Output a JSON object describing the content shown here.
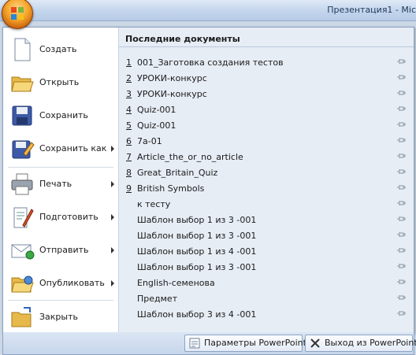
{
  "window": {
    "title": "Презентация1 - Mic"
  },
  "menu_commands": [
    {
      "label": "Создать",
      "has_submenu": false,
      "icon": "new-document-icon"
    },
    {
      "label": "Открыть",
      "has_submenu": false,
      "icon": "open-folder-icon"
    },
    {
      "label": "Сохранить",
      "has_submenu": false,
      "icon": "save-disk-icon"
    },
    {
      "label": "Сохранить как",
      "has_submenu": true,
      "icon": "save-as-icon"
    },
    {
      "label": "Печать",
      "has_submenu": true,
      "icon": "printer-icon"
    },
    {
      "label": "Подготовить",
      "has_submenu": true,
      "icon": "prepare-document-icon"
    },
    {
      "label": "Отправить",
      "has_submenu": true,
      "icon": "send-mail-icon"
    },
    {
      "label": "Опубликовать",
      "has_submenu": true,
      "icon": "publish-folder-icon"
    },
    {
      "label": "Закрыть",
      "has_submenu": false,
      "icon": "close-folder-icon"
    }
  ],
  "recent": {
    "header": "Последние документы",
    "items": [
      {
        "num": "1",
        "name": "001_Заготовка создания тестов"
      },
      {
        "num": "2",
        "name": "УРОКИ-конкурс"
      },
      {
        "num": "3",
        "name": "УРОКИ-конкурс"
      },
      {
        "num": "4",
        "name": "Quiz-001"
      },
      {
        "num": "5",
        "name": "Quiz-001"
      },
      {
        "num": "6",
        "name": "7а-01"
      },
      {
        "num": "7",
        "name": "Article_the_or_no_article"
      },
      {
        "num": "8",
        "name": "Great_Britain_Quiz"
      },
      {
        "num": "9",
        "name": "British Symbols"
      },
      {
        "num": "",
        "name": "к тесту"
      },
      {
        "num": "",
        "name": "Шаблон выбор 1 из 3 -001"
      },
      {
        "num": "",
        "name": "Шаблон выбор 1 из 3 -001"
      },
      {
        "num": "",
        "name": "Шаблон выбор 1 из 4 -001"
      },
      {
        "num": "",
        "name": "Шаблон выбор 1 из 3 -001"
      },
      {
        "num": "",
        "name": "English-семенова"
      },
      {
        "num": "",
        "name": "Предмет"
      },
      {
        "num": "",
        "name": "Шаблон выбор 3 из 4 -001"
      }
    ]
  },
  "bottom": {
    "options_label": "Параметры PowerPoint",
    "exit_label": "Выход из PowerPoint"
  }
}
